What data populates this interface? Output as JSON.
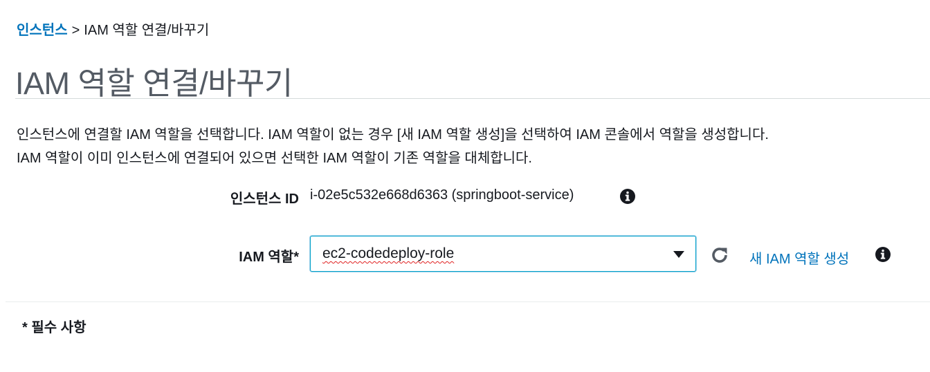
{
  "breadcrumb": {
    "parent": "인스턴스",
    "separator": ">",
    "current": "IAM 역할 연결/바꾸기"
  },
  "page": {
    "title": "IAM 역할 연결/바꾸기"
  },
  "description": {
    "line1": "인스턴스에 연결할 IAM 역할을 선택합니다. IAM 역할이 없는 경우 [새 IAM 역할 생성]을 선택하여 IAM 콘솔에서 역할을 생성합니다.",
    "line2": "IAM 역할이 이미 인스턴스에 연결되어 있으면 선택한 IAM 역할이 기존 역할을 대체합니다."
  },
  "form": {
    "instance_label": "인스턴스 ID",
    "instance_value": "i-02e5c532e668d6363 (springboot-service)",
    "role_label": "IAM 역할*",
    "role_selected": "ec2-codedeploy-role",
    "create_role_link": "새 IAM 역할 생성"
  },
  "footer": {
    "required_note": "* 필수 사항"
  },
  "icons": {
    "info": "info-icon",
    "refresh": "refresh-icon",
    "dropdown": "caret-down-icon"
  },
  "colors": {
    "link": "#0073bb",
    "title": "#545b64",
    "text": "#16191f",
    "focus_border": "#00a1c9",
    "divider": "#d5dbdb"
  }
}
